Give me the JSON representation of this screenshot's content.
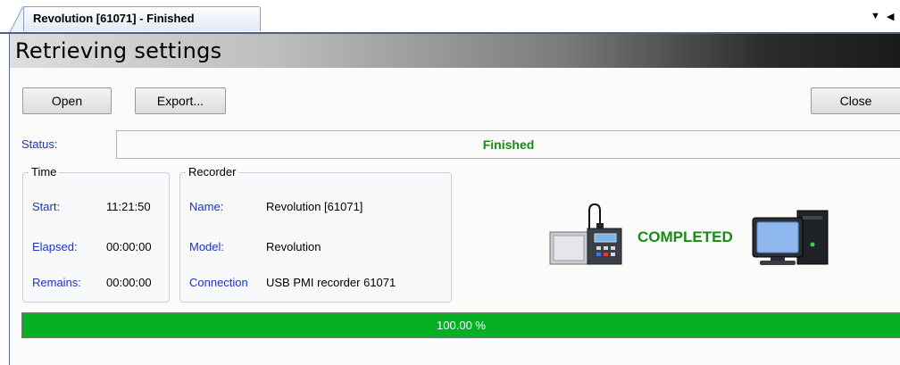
{
  "tab": {
    "title": "Revolution [61071]  - Finished"
  },
  "banner": {
    "title": "Retrieving settings"
  },
  "buttons": {
    "open": "Open",
    "export": "Export...",
    "close": "Close"
  },
  "status": {
    "label": "Status:",
    "value": "Finished"
  },
  "time_group": {
    "title": "Time",
    "start_label": "Start:",
    "start_value": "11:21:50",
    "elapsed_label": "Elapsed:",
    "elapsed_value": "00:00:00",
    "remains_label": "Remains:",
    "remains_value": "00:00:00"
  },
  "recorder_group": {
    "title": "Recorder",
    "name_label": "Name:",
    "name_value": "Revolution [61071]",
    "model_label": "Model:",
    "model_value": "Revolution",
    "connection_label": "Connection",
    "connection_value": "USB PMI recorder 61071"
  },
  "transfer": {
    "status_text": "COMPLETED",
    "source_icon": "recorder-device-icon",
    "target_icon": "computer-icon"
  },
  "progress": {
    "percent": 100,
    "label": "100.00 %"
  },
  "colors": {
    "status_green": "#1a8a1a",
    "progress_green": "#06b025",
    "label_blue": "#1c32c8"
  }
}
